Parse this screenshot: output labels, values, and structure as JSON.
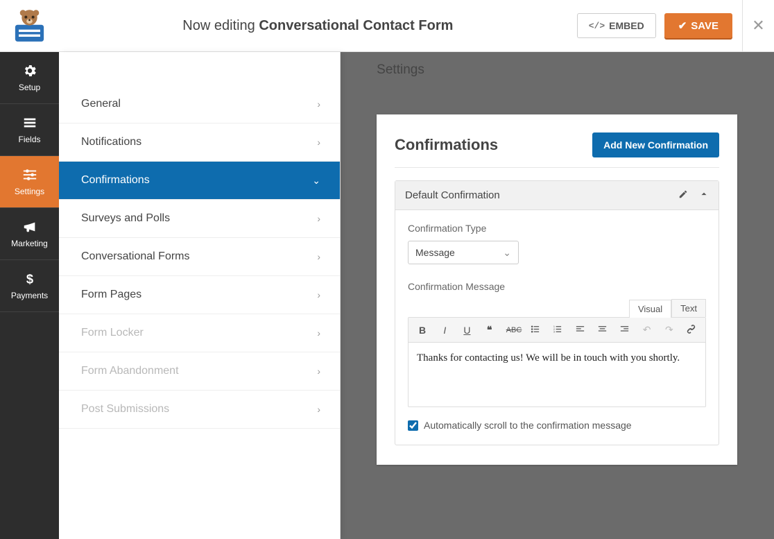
{
  "topbar": {
    "editing_prefix": "Now editing ",
    "editing_name": "Conversational Contact Form",
    "embed_label": "EMBED",
    "save_label": "SAVE"
  },
  "nav": {
    "setup": "Setup",
    "fields": "Fields",
    "settings": "Settings",
    "marketing": "Marketing",
    "payments": "Payments"
  },
  "settings_page": {
    "title": "Settings",
    "items": [
      {
        "label": "General",
        "active": false,
        "disabled": false
      },
      {
        "label": "Notifications",
        "active": false,
        "disabled": false
      },
      {
        "label": "Confirmations",
        "active": true,
        "disabled": false
      },
      {
        "label": "Surveys and Polls",
        "active": false,
        "disabled": false
      },
      {
        "label": "Conversational Forms",
        "active": false,
        "disabled": false
      },
      {
        "label": "Form Pages",
        "active": false,
        "disabled": false
      },
      {
        "label": "Form Locker",
        "active": false,
        "disabled": true
      },
      {
        "label": "Form Abandonment",
        "active": false,
        "disabled": true
      },
      {
        "label": "Post Submissions",
        "active": false,
        "disabled": true
      }
    ]
  },
  "confirmations": {
    "heading": "Confirmations",
    "add_button": "Add New Confirmation",
    "card_title": "Default Confirmation",
    "type_label": "Confirmation Type",
    "type_value": "Message",
    "message_label": "Confirmation Message",
    "tabs": {
      "visual": "Visual",
      "text": "Text"
    },
    "message_value": "Thanks for contacting us! We will be in touch with you shortly.",
    "auto_scroll_label": "Automatically scroll to the confirmation message",
    "auto_scroll_checked": true
  }
}
